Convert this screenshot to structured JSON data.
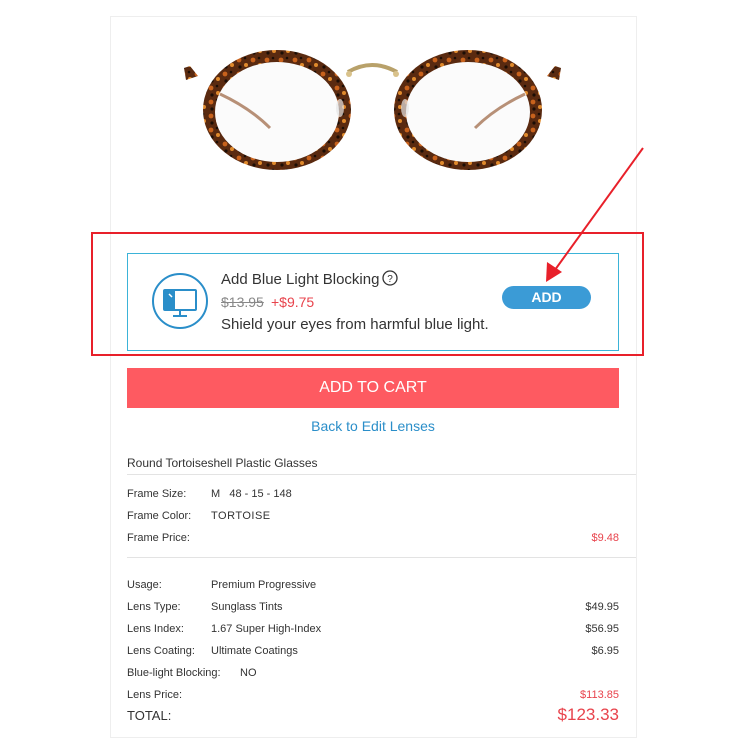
{
  "offer": {
    "title": "Add Blue Light Blocking",
    "old_price": "$13.95",
    "new_price": "+$9.75",
    "description": "Shield your eyes from harmful blue light.",
    "add_label": "ADD",
    "icon": "monitor-blue-light-icon"
  },
  "cart": {
    "add_to_cart_label": "ADD TO CART",
    "back_link": "Back to Edit Lenses"
  },
  "summary": {
    "product_name": "Round Tortoiseshell Plastic Glasses",
    "frame": {
      "size_label": "Frame Size:",
      "size_value": "M   48 - 15 - 148",
      "color_label": "Frame Color:",
      "color_value": "TORTOISE",
      "price_label": "Frame Price:",
      "price_value": "$9.48"
    },
    "lens": {
      "usage_label": "Usage:",
      "usage_value": "Premium Progressive",
      "type_label": "Lens Type:",
      "type_value": "Sunglass Tints",
      "type_price": "$49.95",
      "index_label": "Lens Index:",
      "index_value": "1.67 Super High-Index",
      "index_price": "$56.95",
      "coating_label": "Lens Coating:",
      "coating_value": "Ultimate Coatings",
      "coating_price": "$6.95",
      "blue_label": "Blue-light Blocking:",
      "blue_value": "NO",
      "price_label": "Lens Price:",
      "price_value": "$113.85"
    },
    "total_label": "TOTAL:",
    "total_value": "$123.33"
  },
  "colors": {
    "accent_red": "#e8434c",
    "button_blue": "#3b9bd6",
    "cart_red": "#fe5a61",
    "offer_border": "#3bb3d8",
    "highlight_red": "#e8202a"
  }
}
